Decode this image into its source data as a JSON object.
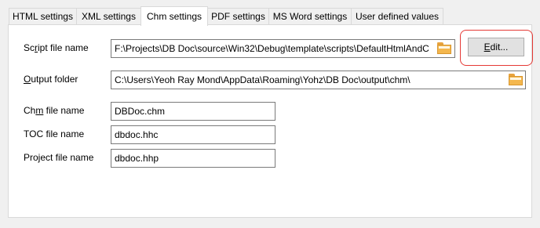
{
  "tabs": [
    {
      "label": "HTML settings"
    },
    {
      "label": "XML settings"
    },
    {
      "label": "Chm settings"
    },
    {
      "label": "PDF settings"
    },
    {
      "label": "MS Word settings"
    },
    {
      "label": "User defined values"
    }
  ],
  "active_tab": "Chm settings",
  "script_file": {
    "label_pre": "Sc",
    "label_u": "r",
    "label_post": "ipt file name",
    "value": "F:\\Projects\\DB Doc\\source\\Win32\\Debug\\template\\scripts\\DefaultHtmlAndC",
    "icon": "folder-icon"
  },
  "edit_button": {
    "pre": "",
    "u": "E",
    "post": "dit..."
  },
  "output_folder": {
    "label_pre": "",
    "label_u": "O",
    "label_post": "utput folder",
    "value": "C:\\Users\\Yeoh Ray Mond\\AppData\\Roaming\\Yohz\\DB Doc\\output\\chm\\",
    "icon": "folder-icon"
  },
  "chm_file": {
    "label_pre": "Ch",
    "label_u": "m",
    "label_post": " file name",
    "value": "DBDoc.chm"
  },
  "toc_file": {
    "label": "TOC file name",
    "value": "dbdoc.hhc"
  },
  "project_file": {
    "label": "Project file name",
    "value": "dbdoc.hhp"
  },
  "colors": {
    "highlight": "#e53935",
    "folder": "#f4b74e"
  }
}
